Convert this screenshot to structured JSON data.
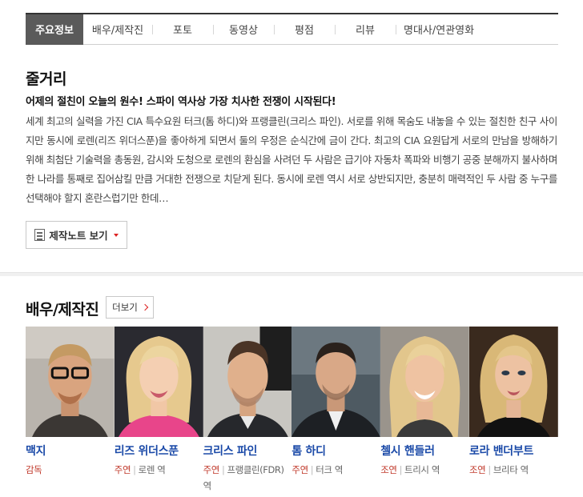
{
  "tabs": [
    {
      "label": "주요정보",
      "active": true
    },
    {
      "label": "배우/제작진"
    },
    {
      "label": "포토"
    },
    {
      "label": "동영상"
    },
    {
      "label": "평점"
    },
    {
      "label": "리뷰"
    },
    {
      "label": "명대사/연관영화"
    }
  ],
  "synopsis": {
    "title": "줄거리",
    "headline": "어제의 절친이 오늘의 원수! 스파이 역사상 가장 치사한 전쟁이 시작된다!",
    "body": "세계 최고의 실력을 가진 CIA 특수요원 터크(톰 하디)와 프랭클린(크리스 파인). 서로를 위해 목숨도 내놓을 수 있는 절친한 친구 사이지만 동시에 로렌(리즈 위더스푼)을 좋아하게 되면서 둘의 우정은 순식간에 금이 간다. 최고의 CIA 요원답게 서로의 만남을 방해하기 위해 최첨단 기술력을 총동원, 감시와 도청으로 로렌의 환심을 사려던 두 사람은 급기야 자동차 폭파와 비행기 공중 분해까지 불사하며 한 나라를 통째로 집어삼킬 만큼 거대한 전쟁으로 치닫게 된다. 동시에 로렌 역시 서로 상반되지만, 충분히 매력적인 두 사람 중 누구를 선택해야 할지 혼란스럽기만 한데…",
    "note_button": "제작노트 보기"
  },
  "cast": {
    "title": "배우/제작진",
    "more_button": "더보기",
    "people": [
      {
        "name": "맥지",
        "type": "감독",
        "role": ""
      },
      {
        "name": "리즈 위더스푼",
        "type": "주연",
        "role": "로렌 역"
      },
      {
        "name": "크리스 파인",
        "type": "주연",
        "role": "프랭클린(FDR) 역"
      },
      {
        "name": "톰 하디",
        "type": "주연",
        "role": "터크 역"
      },
      {
        "name": "첼시 핸들러",
        "type": "조연",
        "role": "트리시 역"
      },
      {
        "name": "로라 밴더부트",
        "type": "조연",
        "role": "브리타 역"
      }
    ]
  },
  "colors": {
    "accent_red": "#c0392b",
    "name_blue": "#1b4aa8",
    "tab_active": "#5a5a5a"
  }
}
